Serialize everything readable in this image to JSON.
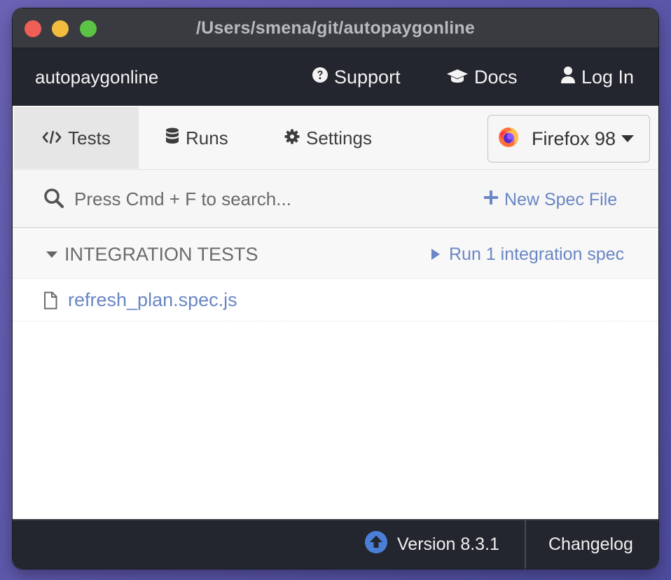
{
  "window": {
    "title": "/Users/smena/git/autopaygonline"
  },
  "topnav": {
    "project_name": "autopaygonline",
    "links": [
      {
        "label": "Support",
        "icon": "question-circle-icon"
      },
      {
        "label": "Docs",
        "icon": "graduation-cap-icon"
      },
      {
        "label": "Log In",
        "icon": "user-icon"
      }
    ]
  },
  "tabs": [
    {
      "label": "Tests",
      "icon": "code-icon",
      "active": true
    },
    {
      "label": "Runs",
      "icon": "database-icon",
      "active": false
    },
    {
      "label": "Settings",
      "icon": "gear-icon",
      "active": false
    }
  ],
  "browser": {
    "selected": "Firefox 98",
    "icon": "firefox-icon"
  },
  "search": {
    "placeholder": "Press Cmd + F to search...",
    "value": ""
  },
  "new_spec": {
    "label": "New Spec File"
  },
  "integration": {
    "title": "INTEGRATION TESTS",
    "run_label": "Run 1 integration spec",
    "specs": [
      {
        "name": "refresh_plan.spec.js"
      }
    ]
  },
  "footer": {
    "version": "Version 8.3.1",
    "changelog": "Changelog"
  },
  "colors": {
    "accent": "#6a86c4",
    "nav_bg": "#23262e",
    "update_icon": "#4a7fd8"
  }
}
